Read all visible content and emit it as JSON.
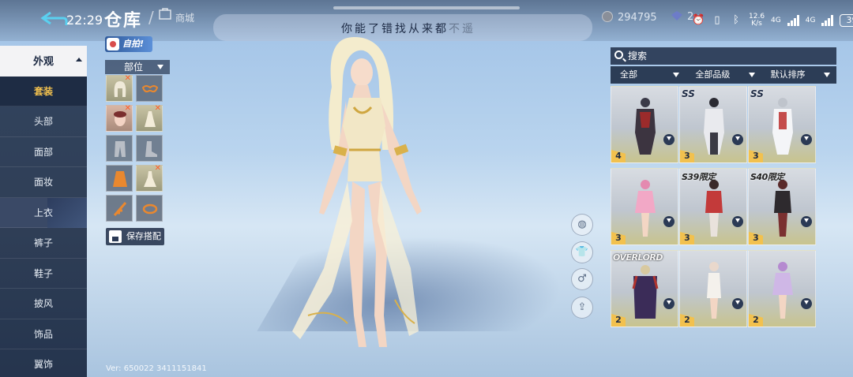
{
  "header": {
    "time": "22:29",
    "title": "仓库",
    "shop_label": "商城",
    "banner_text_main": "你能了错找从来都",
    "banner_text_faded": "不遥",
    "currency_coins": "294795",
    "currency_gems": "2"
  },
  "status_bar": {
    "net_speed_value": "12.6",
    "net_speed_unit": "K/s",
    "sig1": "4G",
    "sig2": "4G",
    "battery": "39"
  },
  "sidebar": {
    "header": "外观",
    "items": [
      {
        "label": "套装",
        "active": true
      },
      {
        "label": "头部"
      },
      {
        "label": "面部"
      },
      {
        "label": "面妆"
      },
      {
        "label": "上衣"
      },
      {
        "label": "裤子"
      },
      {
        "label": "鞋子"
      },
      {
        "label": "披风"
      },
      {
        "label": "饰品"
      },
      {
        "label": "翼饰"
      }
    ]
  },
  "parts": {
    "badge": "自拍!",
    "header": "部位",
    "save_label": "保存搭配"
  },
  "version": "Ver: 650022 3411151841",
  "right_panel": {
    "search_label": "搜索",
    "filters": [
      "全部",
      "全部品级",
      "默认排序"
    ],
    "cards": [
      {
        "level": "4",
        "tag": ""
      },
      {
        "level": "3",
        "tag": "SS"
      },
      {
        "level": "3",
        "tag": "SS"
      },
      {
        "level": "3",
        "tag": ""
      },
      {
        "level": "3",
        "tag": "S39限定"
      },
      {
        "level": "3",
        "tag": "S40限定"
      },
      {
        "level": "2",
        "tag": "OVERLORD"
      },
      {
        "level": "2",
        "tag": ""
      },
      {
        "level": "2",
        "tag": ""
      }
    ]
  },
  "colors": {
    "accent_gold": "#f2c14e",
    "panel_navy": "#1e2c44",
    "sky": "#b9d4ee"
  }
}
